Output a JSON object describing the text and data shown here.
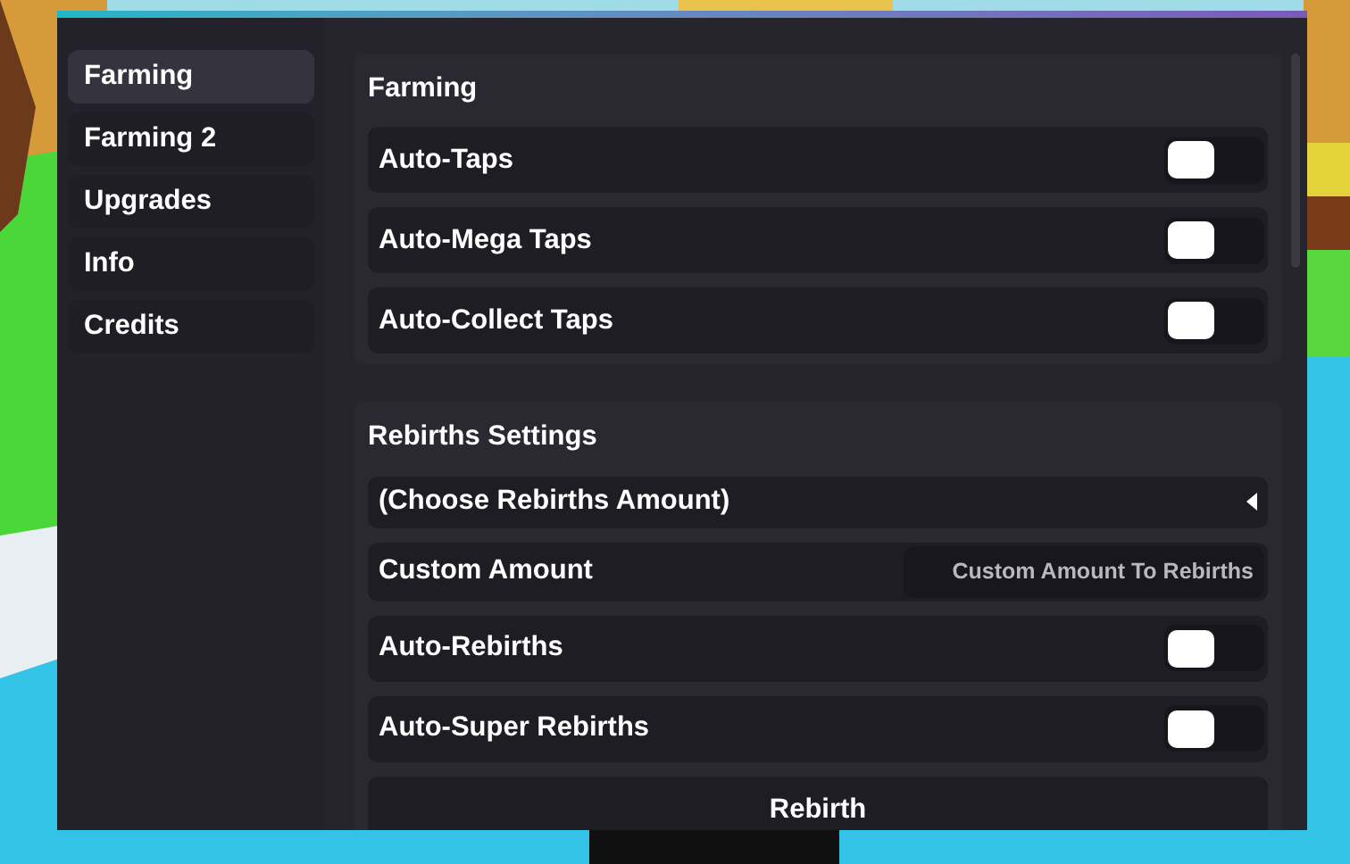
{
  "sidebar": {
    "items": [
      {
        "label": "Farming",
        "selected": true
      },
      {
        "label": "Farming 2",
        "selected": false
      },
      {
        "label": "Upgrades",
        "selected": false
      },
      {
        "label": "Info",
        "selected": false
      },
      {
        "label": "Credits",
        "selected": false
      }
    ]
  },
  "sections": [
    {
      "title": "Farming",
      "rows": [
        {
          "kind": "toggle",
          "label": "Auto-Taps",
          "on": false
        },
        {
          "kind": "toggle",
          "label": "Auto-Mega Taps",
          "on": false
        },
        {
          "kind": "toggle",
          "label": "Auto-Collect Taps",
          "on": false
        }
      ]
    },
    {
      "title": "Rebirths Settings",
      "rows": [
        {
          "kind": "dropdown",
          "label": "(Choose Rebirths Amount)"
        },
        {
          "kind": "input",
          "label": "Custom Amount",
          "placeholder": "Custom Amount To Rebirths"
        },
        {
          "kind": "toggle",
          "label": "Auto-Rebirths",
          "on": false
        },
        {
          "kind": "toggle",
          "label": "Auto-Super Rebirths",
          "on": false
        },
        {
          "kind": "button",
          "label": "Rebirth"
        }
      ]
    }
  ]
}
